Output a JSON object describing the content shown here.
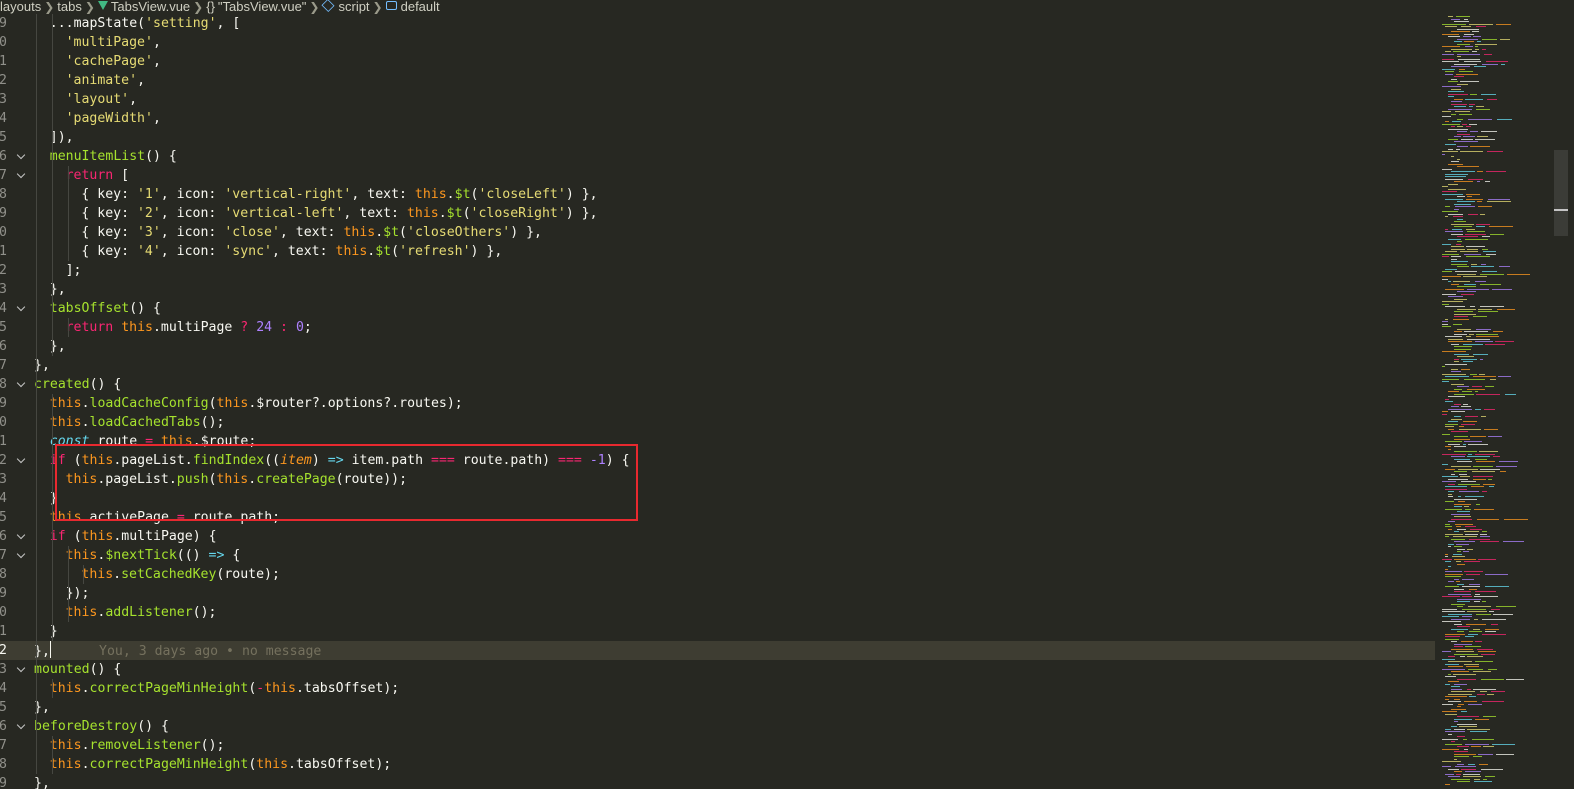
{
  "breadcrumb": {
    "parts": [
      "layouts",
      "tabs",
      "TabsView.vue",
      "\"TabsView.vue\"",
      "script",
      "default"
    ],
    "icons": [
      "vue-icon",
      "braces-icon",
      "cube-icon",
      "field-icon"
    ]
  },
  "editor": {
    "colors": {
      "background": "#272822",
      "keyword": "#f92672",
      "function": "#a6e22e",
      "string": "#e6db74",
      "number": "#ae81ff",
      "this": "#fd971f",
      "highlight_box": "#e8292f"
    },
    "current_line": "2",
    "line_numbers": [
      "9",
      "0",
      "1",
      "2",
      "3",
      "4",
      "5",
      "6",
      "7",
      "8",
      "9",
      "0",
      "1",
      "2",
      "3",
      "4",
      "5",
      "6",
      "7",
      "8",
      "9",
      "0",
      "1",
      "2",
      "3",
      "4",
      "5",
      "6",
      "7",
      "8",
      "9",
      "0",
      "1",
      "2",
      "3",
      "4",
      "5",
      "6",
      "7",
      "8",
      "9"
    ],
    "lines": [
      {
        "s": [
          {
            "t": "...mapState(",
            "c": ""
          },
          {
            "t": "'setting'",
            "c": "str"
          },
          {
            "t": ", [",
            "c": ""
          }
        ]
      },
      {
        "s": [
          {
            "t": "'multiPage'",
            "c": "str"
          },
          {
            "t": ",",
            "c": ""
          }
        ]
      },
      {
        "s": [
          {
            "t": "'cachePage'",
            "c": "str"
          },
          {
            "t": ",",
            "c": ""
          }
        ]
      },
      {
        "s": [
          {
            "t": "'animate'",
            "c": "str"
          },
          {
            "t": ",",
            "c": ""
          }
        ]
      },
      {
        "s": [
          {
            "t": "'layout'",
            "c": "str"
          },
          {
            "t": ",",
            "c": ""
          }
        ]
      },
      {
        "s": [
          {
            "t": "'pageWidth'",
            "c": "str"
          },
          {
            "t": ",",
            "c": ""
          }
        ]
      },
      {
        "s": [
          {
            "t": "]),",
            "c": ""
          }
        ]
      },
      {
        "s": [
          {
            "t": "menuItemList",
            "c": "fn"
          },
          {
            "t": "() {",
            "c": ""
          }
        ]
      },
      {
        "s": [
          {
            "t": "return",
            "c": "kw"
          },
          {
            "t": " [",
            "c": ""
          }
        ]
      },
      {
        "s": [
          {
            "t": "{ key: ",
            "c": ""
          },
          {
            "t": "'1'",
            "c": "str"
          },
          {
            "t": ", icon: ",
            "c": ""
          },
          {
            "t": "'vertical-right'",
            "c": "str"
          },
          {
            "t": ", text: ",
            "c": ""
          },
          {
            "t": "this",
            "c": "this"
          },
          {
            "t": ".",
            "c": ""
          },
          {
            "t": "$t",
            "c": "fn"
          },
          {
            "t": "(",
            "c": ""
          },
          {
            "t": "'closeLeft'",
            "c": "str"
          },
          {
            "t": ") },",
            "c": ""
          }
        ]
      },
      {
        "s": [
          {
            "t": "{ key: ",
            "c": ""
          },
          {
            "t": "'2'",
            "c": "str"
          },
          {
            "t": ", icon: ",
            "c": ""
          },
          {
            "t": "'vertical-left'",
            "c": "str"
          },
          {
            "t": ", text: ",
            "c": ""
          },
          {
            "t": "this",
            "c": "this"
          },
          {
            "t": ".",
            "c": ""
          },
          {
            "t": "$t",
            "c": "fn"
          },
          {
            "t": "(",
            "c": ""
          },
          {
            "t": "'closeRight'",
            "c": "str"
          },
          {
            "t": ") },",
            "c": ""
          }
        ]
      },
      {
        "s": [
          {
            "t": "{ key: ",
            "c": ""
          },
          {
            "t": "'3'",
            "c": "str"
          },
          {
            "t": ", icon: ",
            "c": ""
          },
          {
            "t": "'close'",
            "c": "str"
          },
          {
            "t": ", text: ",
            "c": ""
          },
          {
            "t": "this",
            "c": "this"
          },
          {
            "t": ".",
            "c": ""
          },
          {
            "t": "$t",
            "c": "fn"
          },
          {
            "t": "(",
            "c": ""
          },
          {
            "t": "'closeOthers'",
            "c": "str"
          },
          {
            "t": ") },",
            "c": ""
          }
        ]
      },
      {
        "s": [
          {
            "t": "{ key: ",
            "c": ""
          },
          {
            "t": "'4'",
            "c": "str"
          },
          {
            "t": ", icon: ",
            "c": ""
          },
          {
            "t": "'sync'",
            "c": "str"
          },
          {
            "t": ", text: ",
            "c": ""
          },
          {
            "t": "this",
            "c": "this"
          },
          {
            "t": ".",
            "c": ""
          },
          {
            "t": "$t",
            "c": "fn"
          },
          {
            "t": "(",
            "c": ""
          },
          {
            "t": "'refresh'",
            "c": "str"
          },
          {
            "t": ") },",
            "c": ""
          }
        ]
      },
      {
        "s": [
          {
            "t": "];",
            "c": ""
          }
        ]
      },
      {
        "s": [
          {
            "t": "},",
            "c": ""
          }
        ]
      },
      {
        "s": [
          {
            "t": "tabsOffset",
            "c": "fn"
          },
          {
            "t": "() {",
            "c": ""
          }
        ]
      },
      {
        "s": [
          {
            "t": "return",
            "c": "kw"
          },
          {
            "t": " ",
            "c": ""
          },
          {
            "t": "this",
            "c": "this"
          },
          {
            "t": ".multiPage ",
            "c": ""
          },
          {
            "t": "?",
            "c": "kw"
          },
          {
            "t": " ",
            "c": ""
          },
          {
            "t": "24",
            "c": "num"
          },
          {
            "t": " ",
            "c": ""
          },
          {
            "t": ":",
            "c": "kw"
          },
          {
            "t": " ",
            "c": ""
          },
          {
            "t": "0",
            "c": "num"
          },
          {
            "t": ";",
            "c": ""
          }
        ]
      },
      {
        "s": [
          {
            "t": "},",
            "c": ""
          }
        ]
      },
      {
        "s": [
          {
            "t": "},",
            "c": ""
          }
        ]
      },
      {
        "s": [
          {
            "t": "created",
            "c": "fn"
          },
          {
            "t": "() {",
            "c": ""
          }
        ]
      },
      {
        "s": [
          {
            "t": "this",
            "c": "this"
          },
          {
            "t": ".",
            "c": ""
          },
          {
            "t": "loadCacheConfig",
            "c": "fn"
          },
          {
            "t": "(",
            "c": ""
          },
          {
            "t": "this",
            "c": "this"
          },
          {
            "t": ".$router?.options?.routes);",
            "c": ""
          }
        ]
      },
      {
        "s": [
          {
            "t": "this",
            "c": "this"
          },
          {
            "t": ".",
            "c": ""
          },
          {
            "t": "loadCachedTabs",
            "c": "fn"
          },
          {
            "t": "();",
            "c": ""
          }
        ]
      },
      {
        "s": [
          {
            "t": "const",
            "c": "store"
          },
          {
            "t": " route ",
            "c": ""
          },
          {
            "t": "=",
            "c": "kw"
          },
          {
            "t": " ",
            "c": ""
          },
          {
            "t": "this",
            "c": "this"
          },
          {
            "t": ".$route;",
            "c": ""
          }
        ]
      },
      {
        "s": [
          {
            "t": "if",
            "c": "kw"
          },
          {
            "t": " (",
            "c": ""
          },
          {
            "t": "this",
            "c": "this"
          },
          {
            "t": ".pageList.",
            "c": ""
          },
          {
            "t": "findIndex",
            "c": "fn"
          },
          {
            "t": "((",
            "c": ""
          },
          {
            "t": "item",
            "c": "param"
          },
          {
            "t": ") ",
            "c": ""
          },
          {
            "t": "=>",
            "c": "store"
          },
          {
            "t": " item.path ",
            "c": ""
          },
          {
            "t": "===",
            "c": "kw"
          },
          {
            "t": " route.path) ",
            "c": ""
          },
          {
            "t": "===",
            "c": "kw"
          },
          {
            "t": " ",
            "c": ""
          },
          {
            "t": "-1",
            "c": "num"
          },
          {
            "t": ") {",
            "c": ""
          }
        ]
      },
      {
        "s": [
          {
            "t": "this",
            "c": "this"
          },
          {
            "t": ".pageList.",
            "c": ""
          },
          {
            "t": "push",
            "c": "fn"
          },
          {
            "t": "(",
            "c": ""
          },
          {
            "t": "this",
            "c": "this"
          },
          {
            "t": ".",
            "c": ""
          },
          {
            "t": "createPage",
            "c": "fn"
          },
          {
            "t": "(route));",
            "c": ""
          }
        ]
      },
      {
        "s": [
          {
            "t": "}",
            "c": ""
          }
        ]
      },
      {
        "s": [
          {
            "t": "this",
            "c": "this"
          },
          {
            "t": ".activePage ",
            "c": ""
          },
          {
            "t": "=",
            "c": "kw"
          },
          {
            "t": " route.path;",
            "c": ""
          }
        ]
      },
      {
        "s": [
          {
            "t": "if",
            "c": "kw"
          },
          {
            "t": " (",
            "c": ""
          },
          {
            "t": "this",
            "c": "this"
          },
          {
            "t": ".multiPage) {",
            "c": ""
          }
        ]
      },
      {
        "s": [
          {
            "t": "this",
            "c": "this"
          },
          {
            "t": ".",
            "c": ""
          },
          {
            "t": "$nextTick",
            "c": "fn"
          },
          {
            "t": "(() ",
            "c": ""
          },
          {
            "t": "=>",
            "c": "store"
          },
          {
            "t": " {",
            "c": ""
          }
        ]
      },
      {
        "s": [
          {
            "t": "this",
            "c": "this"
          },
          {
            "t": ".",
            "c": ""
          },
          {
            "t": "setCachedKey",
            "c": "fn"
          },
          {
            "t": "(route);",
            "c": ""
          }
        ]
      },
      {
        "s": [
          {
            "t": "});",
            "c": ""
          }
        ]
      },
      {
        "s": [
          {
            "t": "this",
            "c": "this"
          },
          {
            "t": ".",
            "c": ""
          },
          {
            "t": "addListener",
            "c": "fn"
          },
          {
            "t": "();",
            "c": ""
          }
        ]
      },
      {
        "s": [
          {
            "t": "}",
            "c": ""
          }
        ]
      },
      {
        "s": [
          {
            "t": "},",
            "c": ""
          },
          {
            "t": "",
            "c": "cursor"
          },
          {
            "t": "      You, 3 days ago • no message",
            "c": "blame"
          }
        ]
      },
      {
        "s": [
          {
            "t": "mounted",
            "c": "fn"
          },
          {
            "t": "() {",
            "c": ""
          }
        ]
      },
      {
        "s": [
          {
            "t": "this",
            "c": "this"
          },
          {
            "t": ".",
            "c": ""
          },
          {
            "t": "correctPageMinHeight",
            "c": "fn"
          },
          {
            "t": "(",
            "c": ""
          },
          {
            "t": "-",
            "c": "kw"
          },
          {
            "t": "this",
            "c": "this"
          },
          {
            "t": ".tabsOffset);",
            "c": ""
          }
        ]
      },
      {
        "s": [
          {
            "t": "},",
            "c": ""
          }
        ]
      },
      {
        "s": [
          {
            "t": "beforeDestroy",
            "c": "fn"
          },
          {
            "t": "() {",
            "c": ""
          }
        ]
      },
      {
        "s": [
          {
            "t": "this",
            "c": "this"
          },
          {
            "t": ".",
            "c": ""
          },
          {
            "t": "removeListener",
            "c": "fn"
          },
          {
            "t": "();",
            "c": ""
          }
        ]
      },
      {
        "s": [
          {
            "t": "this",
            "c": "this"
          },
          {
            "t": ".",
            "c": ""
          },
          {
            "t": "correctPageMinHeight",
            "c": "fn"
          },
          {
            "t": "(",
            "c": ""
          },
          {
            "t": "this",
            "c": "this"
          },
          {
            "t": ".tabsOffset);",
            "c": ""
          }
        ]
      },
      {
        "s": [
          {
            "t": "},",
            "c": ""
          }
        ]
      }
    ]
  }
}
